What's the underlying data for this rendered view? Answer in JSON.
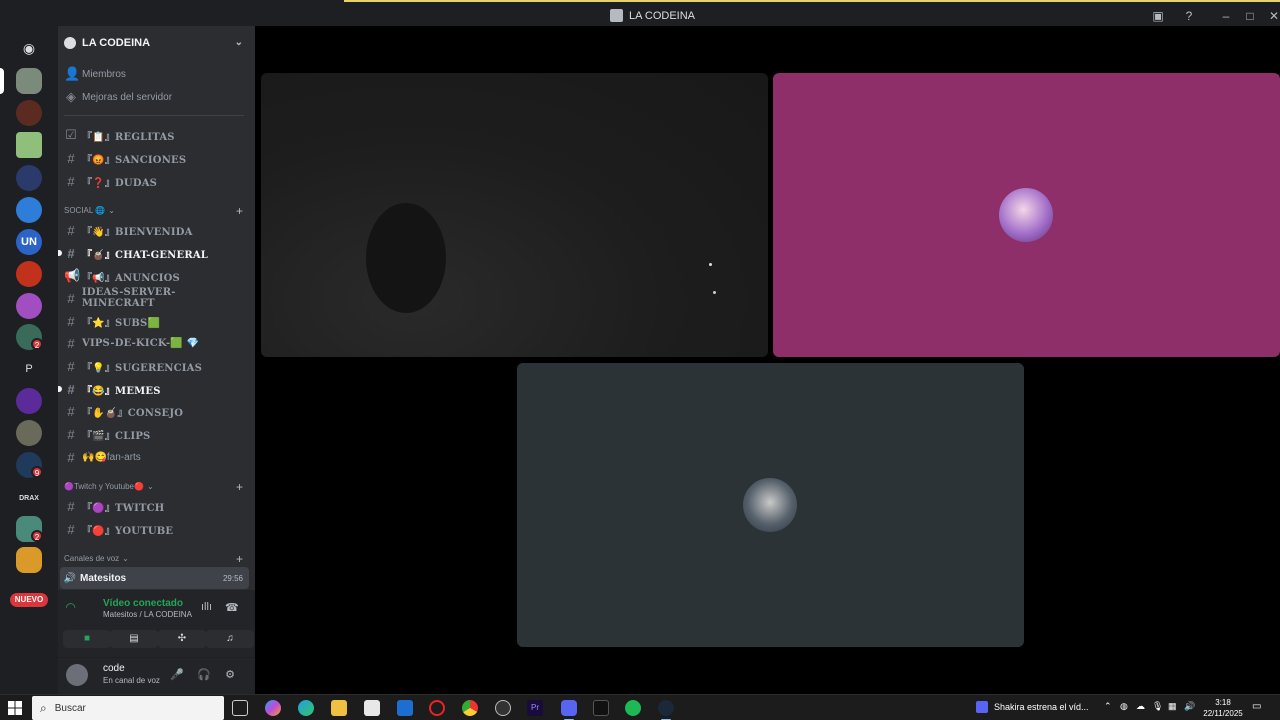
{
  "window": {
    "title": "LA CODEINA"
  },
  "server": {
    "name": "LA CODEINA",
    "top_items": [
      {
        "label": "Miembros",
        "icon": "members-icon"
      },
      {
        "label": "Mejoras del servidor",
        "icon": "boost-icon"
      }
    ],
    "channels_top": [
      {
        "label": "『📋』REGLITAS",
        "icon": "rules-icon"
      },
      {
        "label": "『😡』SANCIONES",
        "icon": "hash-icon"
      },
      {
        "label": "『❓』DUDAS",
        "icon": "hash-icon"
      }
    ],
    "social_category": "SOCIAL 🌐",
    "social_channels": [
      {
        "label": "『👋』BIENVENIDA",
        "icon": "hash-icon",
        "unread": false
      },
      {
        "label": "『🧉』CHAT-GENERAL",
        "icon": "hash-icon",
        "unread": true
      },
      {
        "label": "『📢』ANUNCIOS",
        "icon": "megaphone-icon",
        "unread": false
      },
      {
        "label": "IDEAS-SERVER-MINECRAFT",
        "icon": "hash-icon",
        "unread": false
      },
      {
        "label": "『⭐』SUBS🟩",
        "icon": "hash-icon",
        "unread": false
      },
      {
        "label": "VIPS-DE-KICK-🟩 💎",
        "icon": "hash-icon",
        "unread": false
      },
      {
        "label": "『💡』SUGERENCIAS",
        "icon": "hash-icon",
        "unread": false
      },
      {
        "label": "『😂』MEMES",
        "icon": "hash-icon",
        "unread": true
      },
      {
        "label": "『✋🧉』CONSEJO",
        "icon": "hash-icon",
        "unread": false
      },
      {
        "label": "『🎬』CLIPS",
        "icon": "hash-icon",
        "unread": false
      },
      {
        "label": "🙌😋fan-arts",
        "icon": "hash-icon",
        "unread": false
      }
    ],
    "twitch_category": "🟣Twitch y Youtube🔴",
    "twitch_channels": [
      {
        "label": "『🟣』TWITCH",
        "icon": "hash-icon"
      },
      {
        "label": "『🔴』YOUTUBE",
        "icon": "hash-icon"
      }
    ],
    "voice_category": "Canales de voz",
    "voice_channel": {
      "label": "Matesitos",
      "time": "29:56"
    }
  },
  "rail": {
    "nuevo_label": "NUEVO",
    "badges": [
      "2",
      "9",
      "2"
    ],
    "letter_server": "P",
    "drax_label": "DRAX"
  },
  "voice_panel": {
    "status": "Vídeo conectado",
    "location": "Matesitos / LA CODEINA"
  },
  "user": {
    "name": "code",
    "status": "En canal de voz"
  },
  "taskbar": {
    "search_placeholder": "Buscar",
    "news": "Shakira estrena el víd...",
    "time": "3:18",
    "date": "22/11/2025"
  },
  "colors": {
    "pink_tile": "#8e2f6a",
    "grey_tile": "#2b3336",
    "voice_green": "#23a55a",
    "badge_red": "#da373c"
  }
}
